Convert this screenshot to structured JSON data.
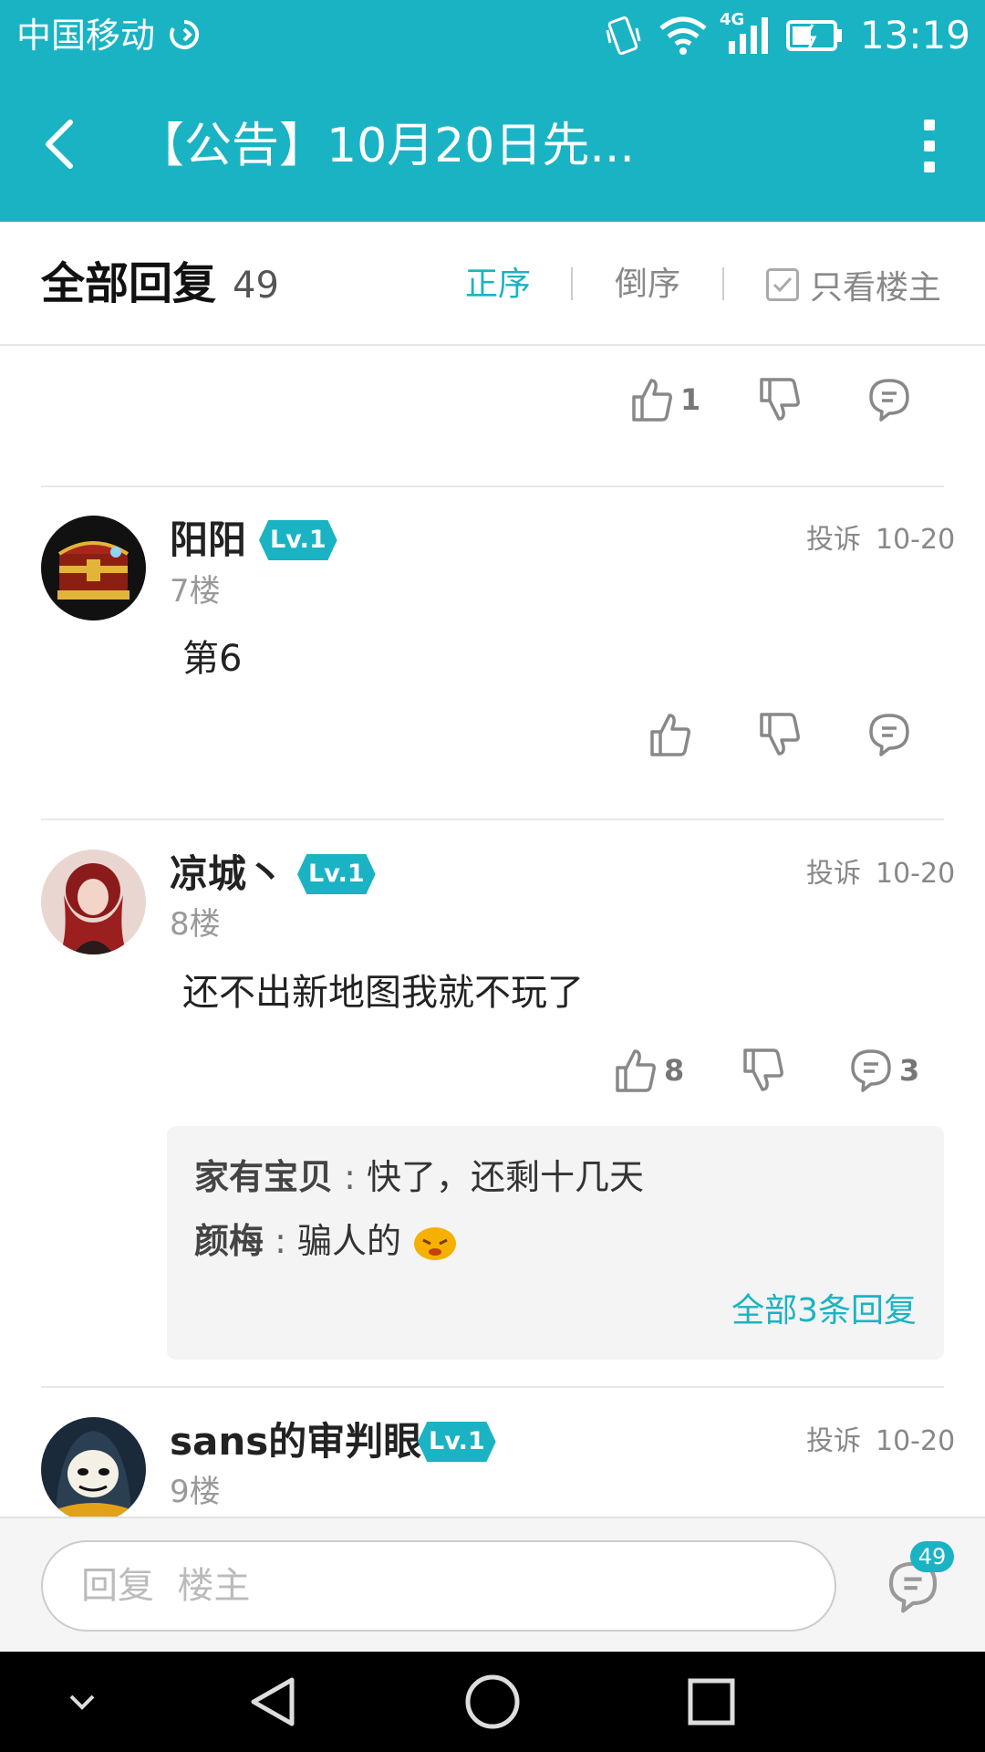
{
  "status_bar": {
    "carrier": "中国移动",
    "network": "4G",
    "time": "13:19"
  },
  "app_bar": {
    "title": "【公告】10月20日先..."
  },
  "filter_bar": {
    "title": "全部回复",
    "count": "49",
    "sort_ascending": "正序",
    "sort_descending": "倒序",
    "only_op": "只看楼主"
  },
  "prev_post_actions": {
    "likes": "1"
  },
  "comments": [
    {
      "user": "阳阳",
      "level": "Lv.1",
      "report": "投诉",
      "date": "10-20",
      "floor": "7楼",
      "content": "第6"
    },
    {
      "user": "凉城丶",
      "level": "Lv.1",
      "report": "投诉",
      "date": "10-20",
      "floor": "8楼",
      "content": "还不出新地图我就不玩了",
      "likes": "8",
      "replies_count": "3",
      "replies": [
        {
          "user": "家有宝贝",
          "sep": " : ",
          "text": "快了，还剩十几天"
        },
        {
          "user": "颜梅",
          "sep": " : ",
          "text": "骗人的"
        }
      ],
      "all_replies_link": "全部3条回复"
    },
    {
      "user": "sans的审判眼",
      "level": "Lv.1",
      "report": "投诉",
      "date": "10-20",
      "floor": "9楼"
    }
  ],
  "bottom_bar": {
    "reply_placeholder": "回复  楼主",
    "comment_badge": "49"
  },
  "colors": {
    "accent": "#1ab3c4",
    "nav_bg": "#000000"
  }
}
